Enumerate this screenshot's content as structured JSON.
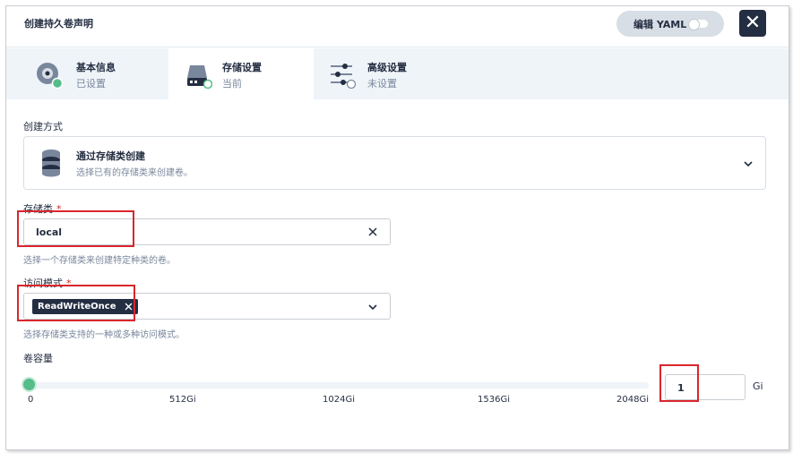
{
  "dialog": {
    "title": "创建持久卷声明",
    "yaml_label": "编辑 YAML",
    "close_symbol": "✕"
  },
  "steps": [
    {
      "title": "基本信息",
      "status": "已设置",
      "icon": "disc-icon",
      "state_color": "#55bc8a"
    },
    {
      "title": "存储设置",
      "status": "当前",
      "icon": "hard-drive-icon",
      "state_color": "#55bc8a"
    },
    {
      "title": "高级设置",
      "status": "未设置",
      "icon": "sliders-icon",
      "state_color": "#ffffff"
    }
  ],
  "form": {
    "creation_method": {
      "label": "创建方式",
      "title": "通过存储类创建",
      "description": "选择已有的存储类来创建卷。",
      "icon": "database-icon"
    },
    "storage_class": {
      "label": "存储类",
      "required_mark": "*",
      "value": "local",
      "hint": "选择一个存储类来创建特定种类的卷。"
    },
    "access_mode": {
      "label": "访问模式",
      "required_mark": "*",
      "tag": "ReadWriteOnce",
      "hint": "选择存储类支持的一种或多种访问模式。"
    },
    "capacity": {
      "label": "卷容量",
      "ticks": [
        "0",
        "512Gi",
        "1024Gi",
        "1536Gi",
        "2048Gi"
      ],
      "value": "1",
      "unit": "Gi",
      "slider_value": 1,
      "slider_max": 2048
    }
  },
  "colors": {
    "primary_dark": "#242e42",
    "success_green": "#55bc8a",
    "annotation_red": "#d9262c"
  }
}
